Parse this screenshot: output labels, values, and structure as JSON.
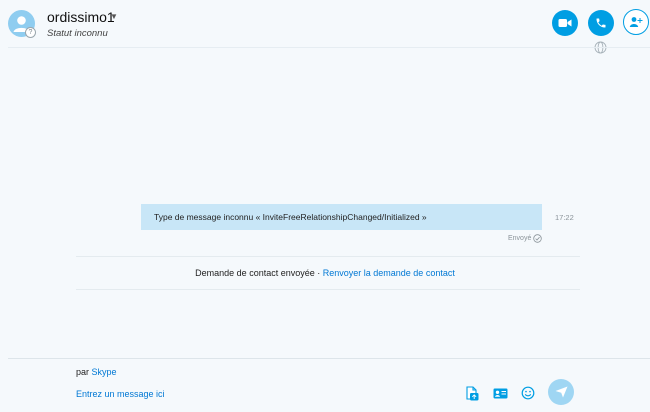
{
  "header": {
    "contact_name": "ordissimo1",
    "contact_status": "Statut inconnu",
    "status_glyph": "?",
    "icons": [
      "avatar-icon",
      "chevron-down-icon",
      "video-camera-icon",
      "phone-icon",
      "add-person-icon",
      "globe-icon"
    ]
  },
  "conversation": {
    "message": {
      "text": "Type de message inconnu « InviteFreeRelationshipChanged/Initialized »",
      "time": "17:22",
      "status": "Envoyé"
    },
    "contact_request": {
      "notice": "Demande de contact envoyée",
      "separator": " · ",
      "resend_label": "Renvoyer la demande de contact"
    }
  },
  "compose": {
    "via_prefix": "par",
    "via_service": "Skype",
    "placeholder": "Entrez un message ici",
    "icons": [
      "file-share-icon",
      "contact-card-icon",
      "emoji-icon",
      "send-icon"
    ]
  },
  "colors": {
    "accent": "#009ee3",
    "bubble": "#c8e6f7",
    "link": "#0078d4",
    "background": "#f5f9fc",
    "send_disabled": "#9fd6f3"
  }
}
